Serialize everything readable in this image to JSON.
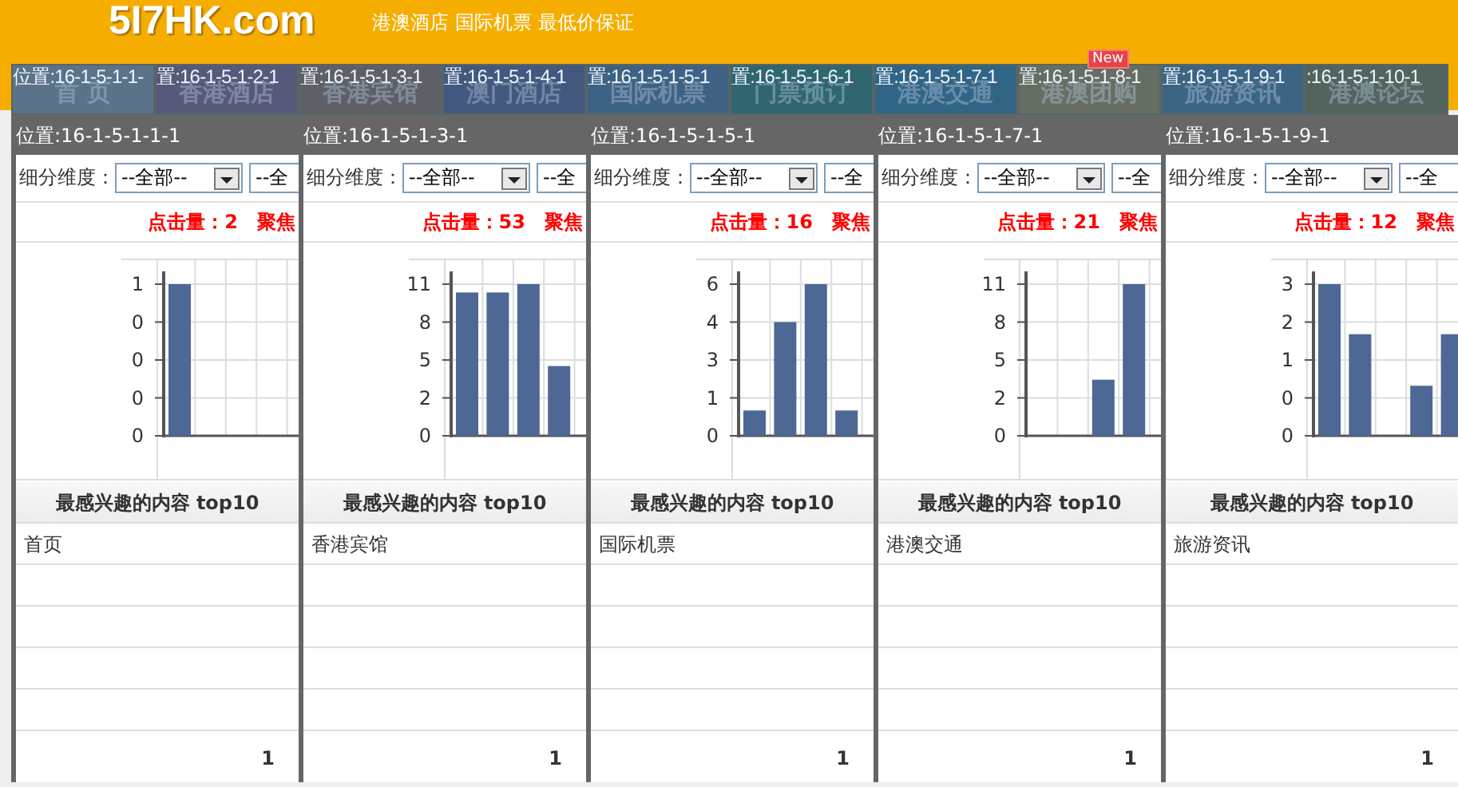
{
  "header": {
    "logo": "5I7HK.com",
    "slogan": "港澳酒店 国际机票 最低价保证"
  },
  "nav": {
    "tabs": [
      {
        "label": "首 页",
        "position_label": "位置:16-1-5-1-1-",
        "color": "#5a7389"
      },
      {
        "label": "香港酒店",
        "position_label": "置:16-1-5-1-2-1",
        "color": "#56597a"
      },
      {
        "label": "香港宾馆",
        "position_label": "置:16-1-5-1-3-1",
        "color": "#5f6066"
      },
      {
        "label": "澳门酒店",
        "position_label": "置:16-1-5-1-4-1",
        "color": "#42587e"
      },
      {
        "label": "国际机票",
        "position_label": "置:16-1-5-1-5-1",
        "color": "#3e6283"
      },
      {
        "label": "门票预订",
        "position_label": "置:16-1-5-1-6-1",
        "color": "#2f6670"
      },
      {
        "label": "港澳交通",
        "position_label": "置:16-1-5-1-7-1",
        "color": "#316585"
      },
      {
        "label": "港澳团购",
        "position_label": "置:16-1-5-1-8-1",
        "color": "#666e63",
        "badge": "New"
      },
      {
        "label": "旅游资讯",
        "position_label": "置:16-1-5-1-9-1",
        "color": "#3c6584"
      },
      {
        "label": "港澳论坛",
        "position_label": ":16-1-5-1-10-1",
        "color": "#53645e"
      }
    ]
  },
  "panels": [
    {
      "position": "位置:16-1-5-1-1-1",
      "filter_label": "细分维度：",
      "select_value": "--全部--",
      "select2_value": "--全",
      "clicks": "点击量：2",
      "focus": "聚焦",
      "chart": {
        "y_labels": [
          "1",
          "0",
          "0",
          "0",
          "0"
        ]
      },
      "top10_title": "最感兴趣的内容 top10",
      "items": [
        "首页"
      ],
      "footer_count": "1"
    },
    {
      "position": "位置:16-1-5-1-3-1",
      "filter_label": "细分维度：",
      "select_value": "--全部--",
      "select2_value": "--全",
      "clicks": "点击量：53",
      "focus": "聚焦",
      "chart": {
        "y_labels": [
          "11",
          "8",
          "5",
          "2",
          "0"
        ]
      },
      "top10_title": "最感兴趣的内容 top10",
      "items": [
        "香港宾馆"
      ],
      "footer_count": "1"
    },
    {
      "position": "位置:16-1-5-1-5-1",
      "filter_label": "细分维度：",
      "select_value": "--全部--",
      "select2_value": "--全",
      "clicks": "点击量：16",
      "focus": "聚焦",
      "chart": {
        "y_labels": [
          "6",
          "4",
          "3",
          "1",
          "0"
        ]
      },
      "top10_title": "最感兴趣的内容 top10",
      "items": [
        "国际机票"
      ],
      "footer_count": "1"
    },
    {
      "position": "位置:16-1-5-1-7-1",
      "filter_label": "细分维度：",
      "select_value": "--全部--",
      "select2_value": "--全",
      "clicks": "点击量：21",
      "focus": "聚焦",
      "chart": {
        "y_labels": [
          "11",
          "8",
          "5",
          "2",
          "0"
        ]
      },
      "top10_title": "最感兴趣的内容 top10",
      "items": [
        "港澳交通"
      ],
      "footer_count": "1"
    },
    {
      "position": "位置:16-1-5-1-9-1",
      "filter_label": "细分维度：",
      "select_value": "--全部--",
      "select2_value": "--全",
      "clicks": "点击量：12",
      "focus": "聚焦",
      "chart": {
        "y_labels": [
          "3",
          "2",
          "1",
          "0",
          "0"
        ]
      },
      "top10_title": "最感兴趣的内容 top10",
      "items": [
        "旅游资讯"
      ],
      "footer_count": "1"
    }
  ]
}
